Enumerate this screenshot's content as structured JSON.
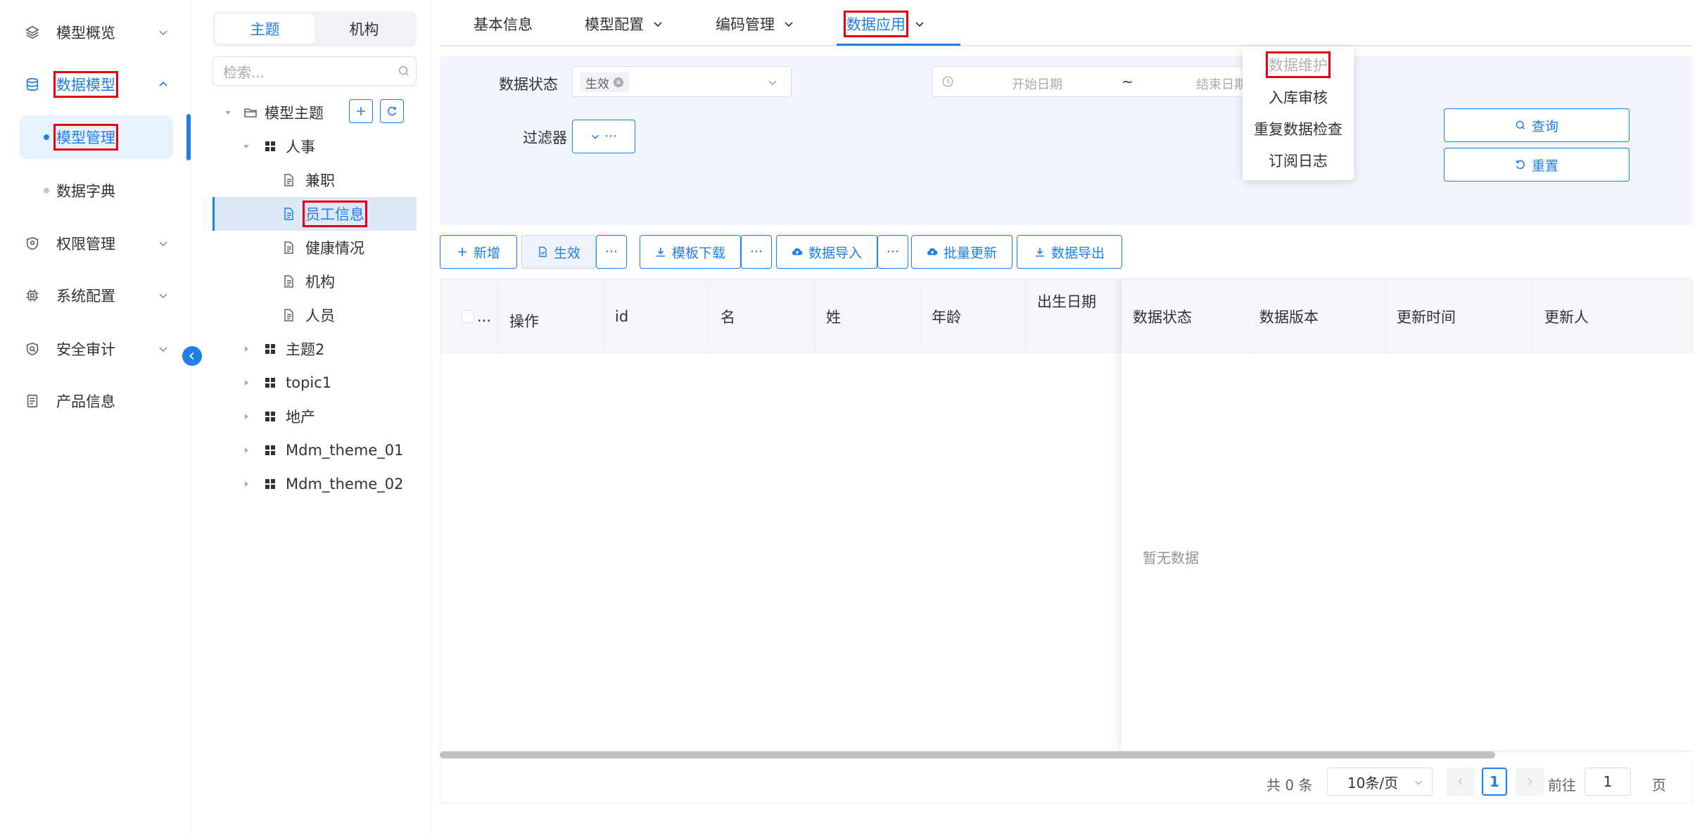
{
  "sidebar": {
    "items": [
      {
        "label": "模型概览",
        "icon": "layers-icon"
      },
      {
        "label": "数据模型",
        "icon": "database-icon"
      },
      {
        "label": "权限管理",
        "icon": "shield-icon"
      },
      {
        "label": "系统配置",
        "icon": "chip-icon"
      },
      {
        "label": "安全审计",
        "icon": "audit-shield-icon"
      },
      {
        "label": "产品信息",
        "icon": "document-icon"
      }
    ],
    "subitems": [
      {
        "label": "模型管理"
      },
      {
        "label": "数据字典"
      }
    ]
  },
  "tree": {
    "tabs": [
      "主题",
      "机构"
    ],
    "search_placeholder": "检索...",
    "root": "模型主题",
    "nodes": [
      {
        "label": "人事"
      },
      {
        "label": "兼职"
      },
      {
        "label": "员工信息"
      },
      {
        "label": "健康情况"
      },
      {
        "label": "机构"
      },
      {
        "label": "人员"
      },
      {
        "label": "主题2"
      },
      {
        "label": "topic1"
      },
      {
        "label": "地产"
      },
      {
        "label": "Mdm_theme_01"
      },
      {
        "label": "Mdm_theme_02"
      }
    ]
  },
  "topnav": {
    "tabs": [
      "基本信息",
      "模型配置",
      "编码管理",
      "数据应用"
    ],
    "dropdown": [
      "数据维护",
      "入库审核",
      "重复数据检查",
      "订阅日志"
    ]
  },
  "filter": {
    "status_label": "数据状态",
    "status_tag": "生效",
    "filter_label": "过滤器",
    "start_placeholder": "开始日期",
    "range_sep": "~",
    "end_placeholder": "结束日期",
    "query": "查询",
    "reset": "重置"
  },
  "toolbar": {
    "add": "新增",
    "effect": "生效",
    "template": "模板下载",
    "import": "数据导入",
    "batch_update": "批量更新",
    "export": "数据导出",
    "more": "···"
  },
  "table": {
    "columns": [
      "...",
      "操作",
      "id",
      "名",
      "姓",
      "年龄",
      "出生日期",
      "数据状态",
      "数据版本",
      "更新时间",
      "更新人"
    ],
    "empty": "暂无数据"
  },
  "pagination": {
    "total": "共 0 条",
    "page_size": "10条/页",
    "current": "1",
    "goto_label": "前往",
    "goto_value": "1",
    "page_suffix": "页"
  },
  "colors": {
    "accent": "#1f7ee8",
    "highlight": "#e60012"
  }
}
